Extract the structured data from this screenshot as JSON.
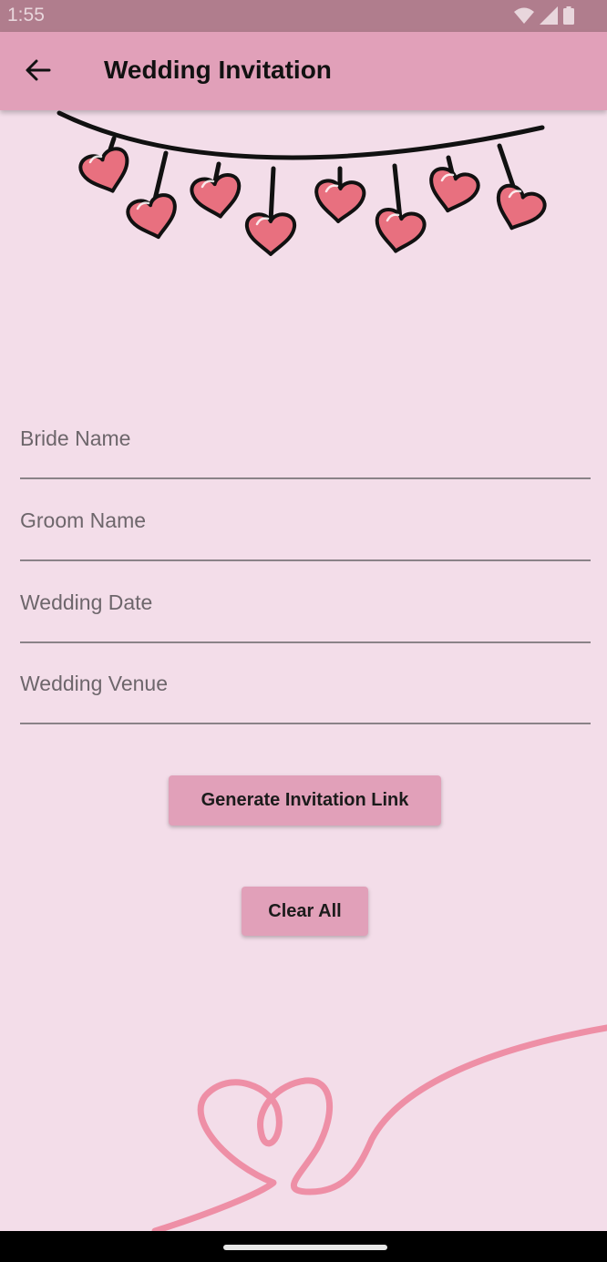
{
  "status_bar": {
    "time": "1:55",
    "icons": [
      "wifi-icon",
      "signal-icon",
      "battery-icon"
    ]
  },
  "app_bar": {
    "title": "Wedding Invitation",
    "back_icon": "arrow-left-icon"
  },
  "form": {
    "fields": [
      {
        "label": "Bride Name",
        "value": ""
      },
      {
        "label": "Groom Name",
        "value": ""
      },
      {
        "label": "Wedding Date",
        "value": ""
      },
      {
        "label": "Wedding Venue",
        "value": ""
      }
    ]
  },
  "buttons": {
    "generate_label": "Generate Invitation Link",
    "clear_label": "Clear All"
  },
  "colors": {
    "background": "#f3dde9",
    "app_bar": "#e1a0b9",
    "button": "#e1a0b9",
    "heart_fill": "#e8707f",
    "swirl": "#ee8fa6"
  }
}
